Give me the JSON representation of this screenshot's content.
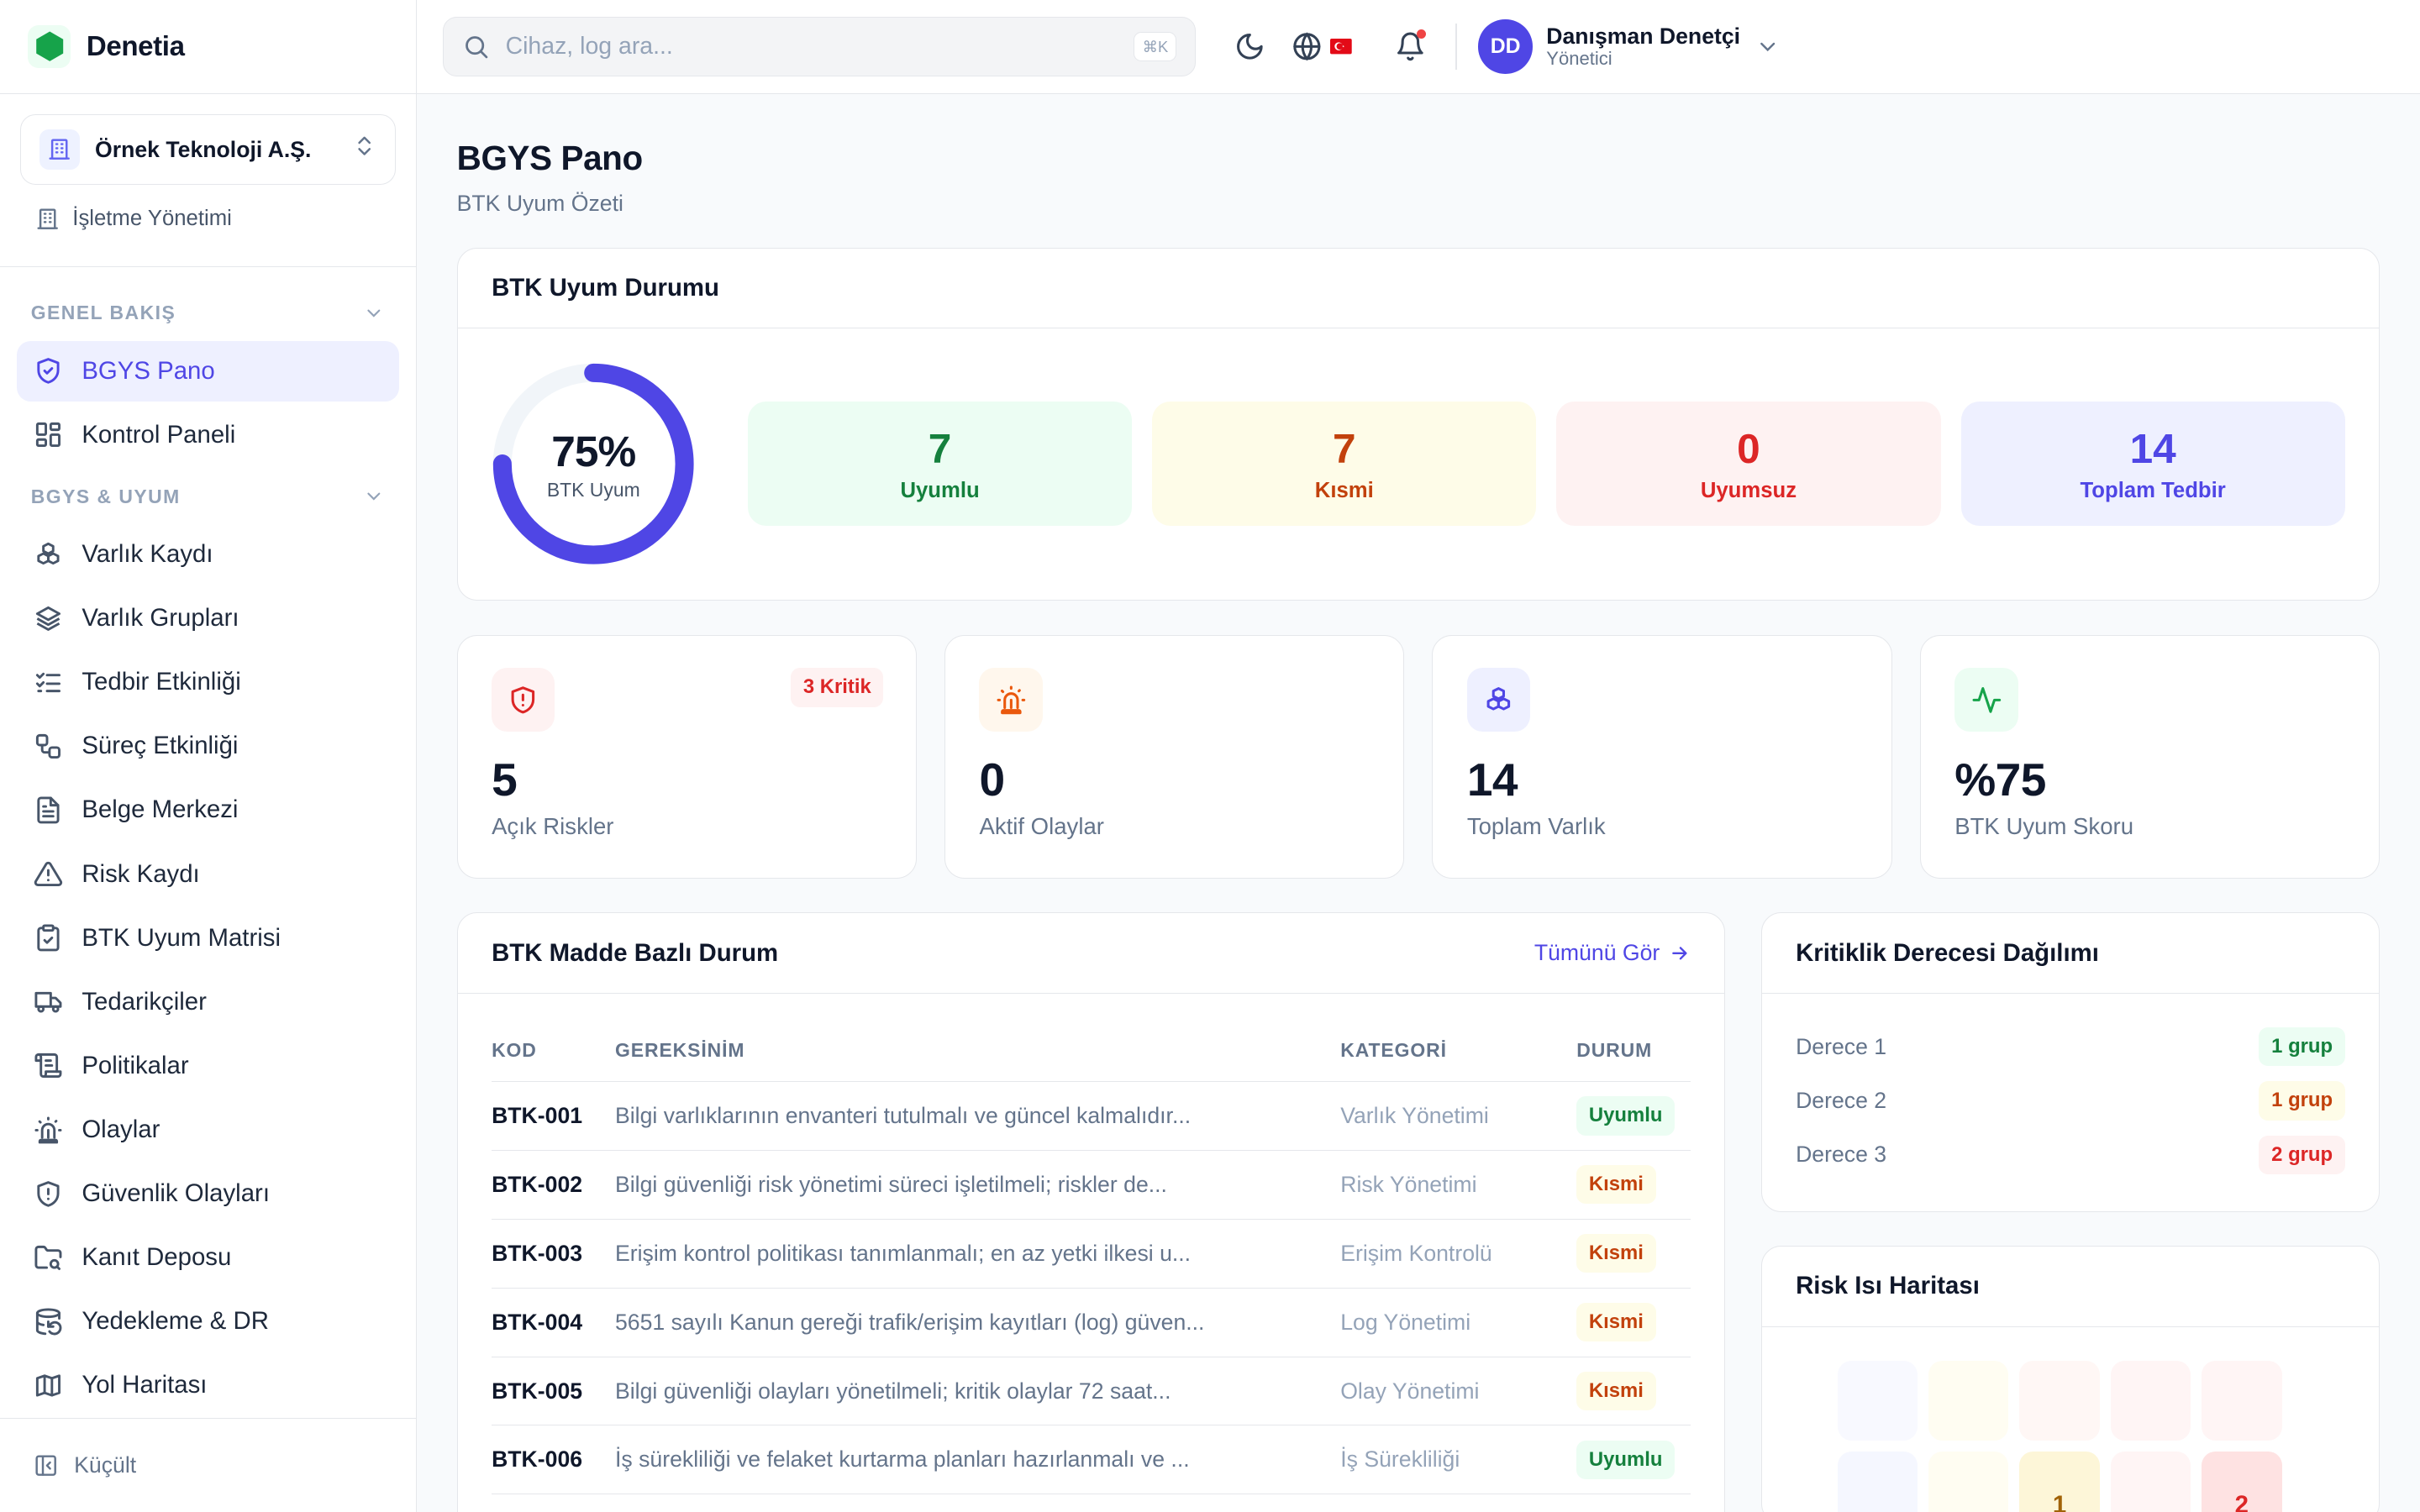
{
  "brand": {
    "name": "Denetia"
  },
  "org": {
    "name": "Örnek Teknoloji A.Ş.",
    "management_label": "İşletme Yönetimi"
  },
  "nav": {
    "section_overview": "GENEL BAKIŞ",
    "section_compliance": "BGYS & UYUM",
    "overview_items": [
      {
        "label": "BGYS Pano",
        "icon": "shield-check-icon",
        "active": true
      },
      {
        "label": "Kontrol Paneli",
        "icon": "dashboard-grid-icon"
      }
    ],
    "compliance_items": [
      {
        "label": "Varlık Kaydı",
        "icon": "boxes-icon"
      },
      {
        "label": "Varlık Grupları",
        "icon": "layers-icon"
      },
      {
        "label": "Tedbir Etkinliği",
        "icon": "list-check-icon"
      },
      {
        "label": "Süreç Etkinliği",
        "icon": "workflow-icon"
      },
      {
        "label": "Belge Merkezi",
        "icon": "file-text-icon"
      },
      {
        "label": "Risk Kaydı",
        "icon": "warning-triangle-icon"
      },
      {
        "label": "BTK Uyum Matrisi",
        "icon": "clipboard-check-icon"
      },
      {
        "label": "Tedarikçiler",
        "icon": "truck-icon"
      },
      {
        "label": "Politikalar",
        "icon": "scroll-icon"
      },
      {
        "label": "Olaylar",
        "icon": "siren-icon"
      },
      {
        "label": "Güvenlik Olayları",
        "icon": "shield-alert-icon"
      },
      {
        "label": "Kanıt Deposu",
        "icon": "folder-search-icon"
      },
      {
        "label": "Yedekleme & DR",
        "icon": "database-backup-icon"
      },
      {
        "label": "Yol Haritası",
        "icon": "map-icon"
      }
    ],
    "collapse_label": "Küçült"
  },
  "topbar": {
    "search_placeholder": "Cihaz, log ara...",
    "search_shortcut": "⌘K",
    "user_initials": "DD",
    "user_name": "Danışman Denetçi",
    "user_role": "Yönetici"
  },
  "page": {
    "title": "BGYS Pano",
    "subtitle": "BTK Uyum Özeti"
  },
  "btk_status": {
    "title": "BTK Uyum Durumu",
    "percent_label": "75%",
    "percent_value": 0.75,
    "percent_caption": "BTK Uyum",
    "boxes": [
      {
        "value": "7",
        "label": "Uyumlu",
        "fg": "#15803d",
        "bg": "#ecfdf3"
      },
      {
        "value": "7",
        "label": "Kısmi",
        "fg": "#c2410c",
        "bg": "#fefce8"
      },
      {
        "value": "0",
        "label": "Uyumsuz",
        "fg": "#dc2626",
        "bg": "#fef2f2"
      },
      {
        "value": "14",
        "label": "Toplam Tedbir",
        "fg": "#4f46e5",
        "bg": "#eef0ff"
      }
    ]
  },
  "kpis": [
    {
      "value": "5",
      "label": "Açık Riskler",
      "badge": "3 Kritik",
      "icon": "shield-alert-icon"
    },
    {
      "value": "0",
      "label": "Aktif Olaylar",
      "icon": "siren-icon"
    },
    {
      "value": "14",
      "label": "Toplam Varlık",
      "icon": "boxes-icon"
    },
    {
      "value": "%75",
      "label": "BTK Uyum Skoru",
      "icon": "activity-icon"
    }
  ],
  "btk_table": {
    "title": "BTK Madde Bazlı Durum",
    "view_all": "Tümünü Gör",
    "headers": [
      "KOD",
      "GEREKSİNİM",
      "KATEGORİ",
      "DURUM"
    ],
    "rows": [
      {
        "code": "BTK-001",
        "requirement": "Bilgi varlıklarının envanteri tutulmalı ve güncel kalmalıdır...",
        "category": "Varlık Yönetimi",
        "status": "Uyumlu"
      },
      {
        "code": "BTK-002",
        "requirement": "Bilgi güvenliği risk yönetimi süreci işletilmeli; riskler de...",
        "category": "Risk Yönetimi",
        "status": "Kısmi"
      },
      {
        "code": "BTK-003",
        "requirement": "Erişim kontrol politikası tanımlanmalı; en az yetki ilkesi u...",
        "category": "Erişim Kontrolü",
        "status": "Kısmi"
      },
      {
        "code": "BTK-004",
        "requirement": "5651 sayılı Kanun gereği trafik/erişim kayıtları (log) güven...",
        "category": "Log Yönetimi",
        "status": "Kısmi"
      },
      {
        "code": "BTK-005",
        "requirement": "Bilgi güvenliği olayları yönetilmeli; kritik olaylar 72 saat...",
        "category": "Olay Yönetimi",
        "status": "Kısmi"
      },
      {
        "code": "BTK-006",
        "requirement": "İş sürekliliği ve felaket kurtarma planları hazırlanmalı ve ...",
        "category": "İş Sürekliliği",
        "status": "Uyumlu"
      }
    ]
  },
  "criticality": {
    "title": "Kritiklik Derecesi Dağılımı",
    "rows": [
      {
        "label": "Derece 1",
        "value": "1 grup",
        "fg": "#15803d",
        "bg": "#ecfdf3"
      },
      {
        "label": "Derece 2",
        "value": "1 grup",
        "fg": "#c2410c",
        "bg": "#fefce8"
      },
      {
        "label": "Derece 3",
        "value": "2 grup",
        "fg": "#dc2626",
        "bg": "#fef2f2"
      }
    ]
  },
  "heatmap": {
    "title": "Risk Isı Haritası",
    "cells": [
      "",
      "",
      "",
      "",
      "",
      "",
      "",
      "1",
      "",
      "2"
    ]
  }
}
